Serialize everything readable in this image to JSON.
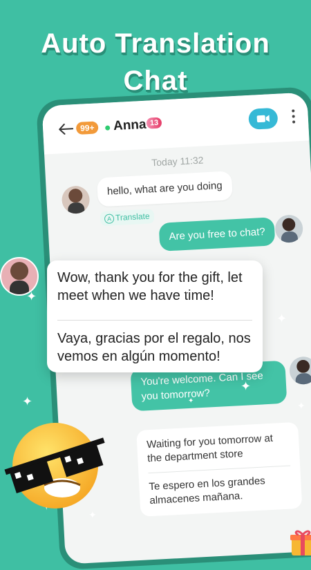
{
  "headline": {
    "line1": "Auto Translation",
    "line2": "Chat"
  },
  "chat_header": {
    "unread_badge": "99+",
    "contact_name": "Anna",
    "level_badge": "13",
    "icons": [
      "arrow-left-icon",
      "video-call-icon",
      "more-vertical-icon"
    ],
    "accent_color": "#36b9d6"
  },
  "timestamp": "Today 11:32",
  "messages": [
    {
      "direction": "in",
      "text": "hello, what are you doing",
      "translate_label": "Translate"
    },
    {
      "direction": "out",
      "text": "Are you free to chat?"
    },
    {
      "direction": "out",
      "text": "You're welcome. Can I see you tomorrow?"
    },
    {
      "direction": "in",
      "text": "Waiting for you tomorrow at the department store",
      "translation": "Te espero en los grandes almacenes mañana."
    }
  ],
  "featured_translation": {
    "original": "Wow, thank you for the gift, let meet when we have time!",
    "translated": "Vaya, gracias por el regalo, nos vemos en algún momento!"
  },
  "colors": {
    "background": "#3fbfa3",
    "outgoing_bubble": "#43c3a6",
    "phone_frame": "#2a8f78"
  }
}
